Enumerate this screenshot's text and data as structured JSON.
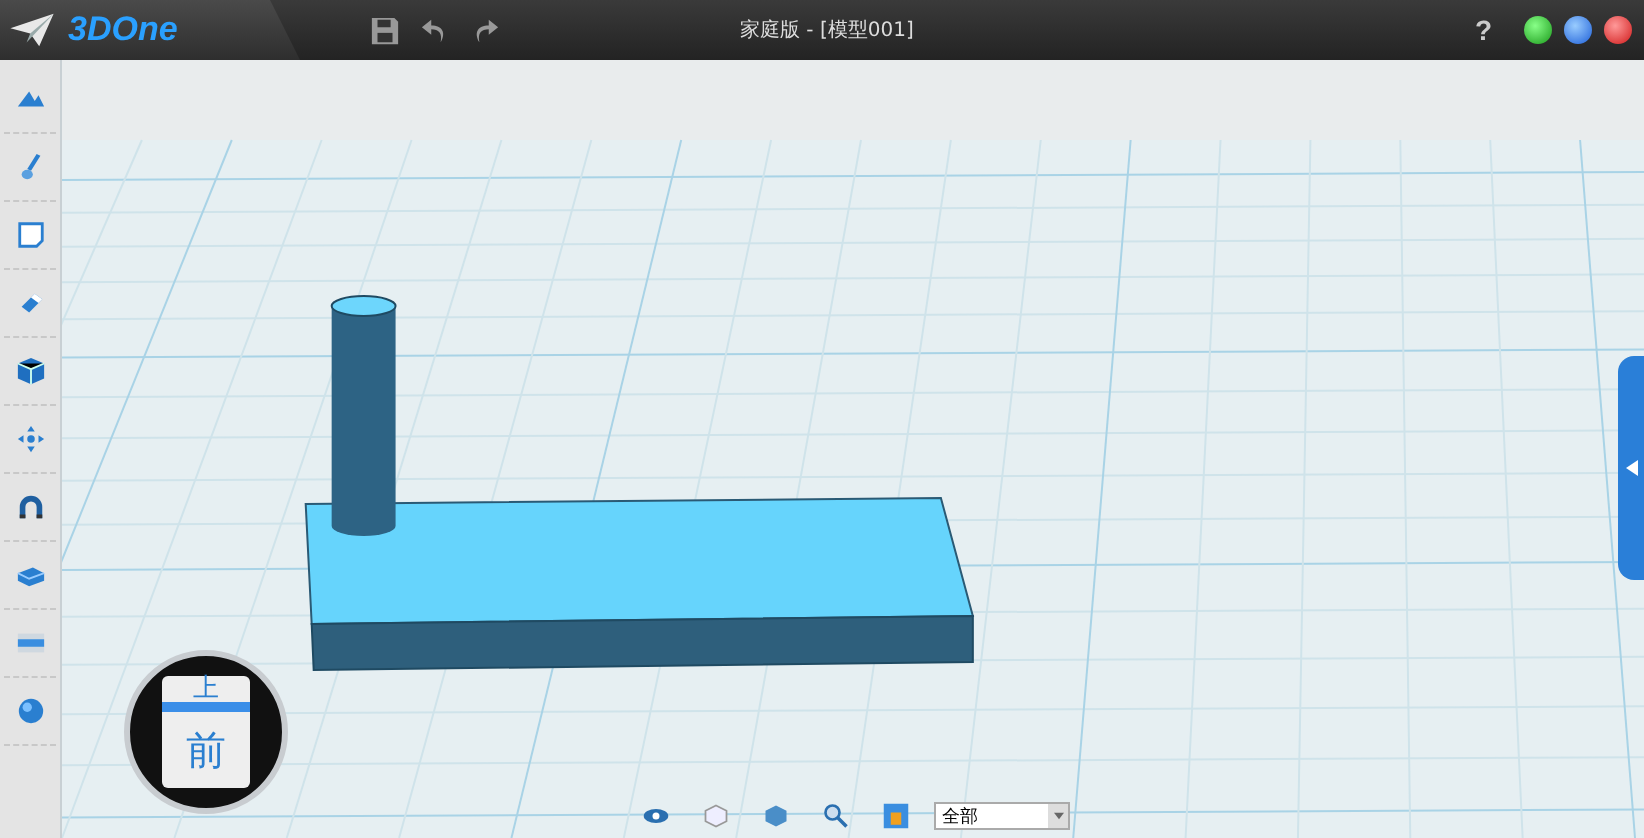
{
  "app": {
    "logo": "3DOne",
    "title": "家庭版 - [模型001]",
    "help": "?"
  },
  "view_cube": {
    "top": "上",
    "front": "前"
  },
  "bottom_toolbar": {
    "filter": {
      "value": "全部"
    }
  }
}
